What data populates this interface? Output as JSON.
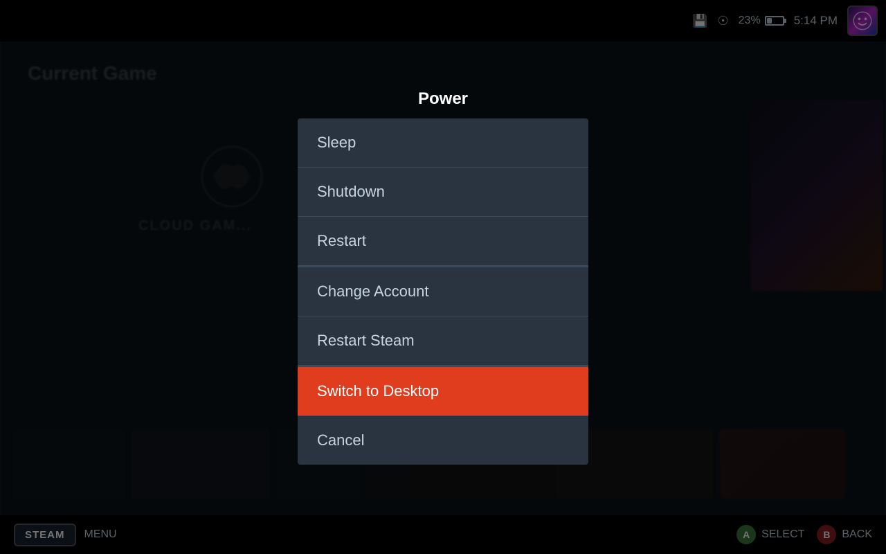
{
  "topbar": {
    "battery_percent": "23%",
    "time": "5:14 PM"
  },
  "background": {
    "current_game_label": "Current Game"
  },
  "dialog": {
    "title": "Power",
    "items": [
      {
        "id": "sleep",
        "label": "Sleep",
        "active": false,
        "separator": false
      },
      {
        "id": "shutdown",
        "label": "Shutdown",
        "active": false,
        "separator": false
      },
      {
        "id": "restart",
        "label": "Restart",
        "active": false,
        "separator": false
      },
      {
        "id": "change-account",
        "label": "Change Account",
        "active": false,
        "separator": true
      },
      {
        "id": "restart-steam",
        "label": "Restart Steam",
        "active": false,
        "separator": false
      },
      {
        "id": "switch-desktop",
        "label": "Switch to Desktop",
        "active": true,
        "separator": true
      },
      {
        "id": "cancel",
        "label": "Cancel",
        "active": false,
        "separator": false
      }
    ]
  },
  "bottombar": {
    "steam_label": "STEAM",
    "menu_label": "MENU",
    "select_label": "SELECT",
    "back_label": "BACK",
    "btn_a": "A",
    "btn_b": "B"
  }
}
